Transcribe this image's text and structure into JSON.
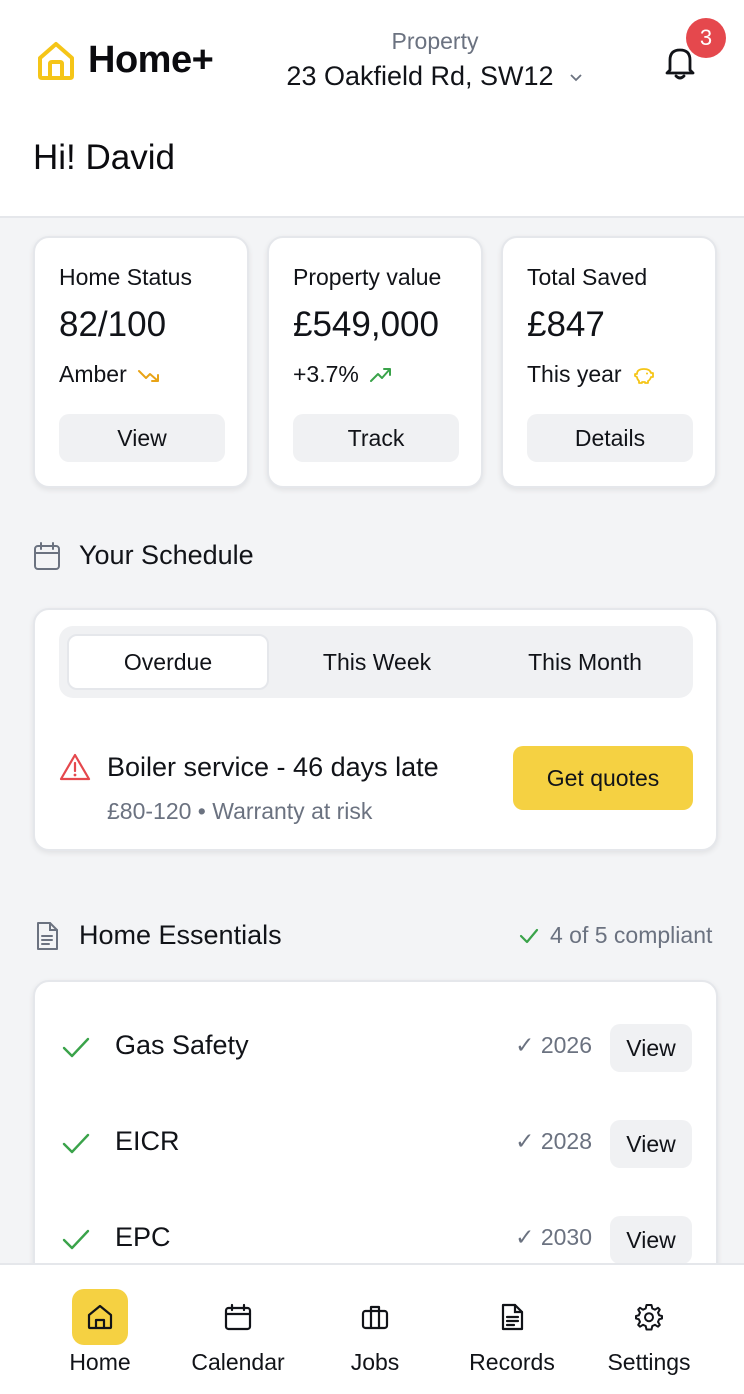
{
  "app": {
    "name": "Home+"
  },
  "header": {
    "property_label": "Property",
    "property_address": "23 Oakfield Rd, SW12",
    "notification_count": "3",
    "greeting": "Hi! David"
  },
  "stats": [
    {
      "label": "Home Status",
      "value": "82/100",
      "sub": "Amber",
      "sub_icon": "trend-down-icon",
      "button": "View"
    },
    {
      "label": "Property value",
      "value": "£549,000",
      "sub": "+3.7%",
      "sub_icon": "trend-up-icon",
      "button": "Track"
    },
    {
      "label": "Total Saved",
      "value": "£847",
      "sub": "This year",
      "sub_icon": "piggy-bank-icon",
      "button": "Details"
    }
  ],
  "schedule": {
    "title": "Your Schedule",
    "tabs": [
      "Overdue",
      "This Week",
      "This Month"
    ],
    "active_tab": "Overdue",
    "alert": {
      "title": "Boiler service - 46 days late",
      "subtitle": "£80-120 • Warranty at risk",
      "button": "Get quotes"
    }
  },
  "essentials": {
    "title": "Home Essentials",
    "compliance": "4 of 5 compliant",
    "items": [
      {
        "name": "Gas Safety",
        "year": "✓ 2026",
        "button": "View"
      },
      {
        "name": "EICR",
        "year": "✓ 2028",
        "button": "View"
      },
      {
        "name": "EPC",
        "year": "✓ 2030",
        "button": "View"
      }
    ]
  },
  "nav": [
    {
      "label": "Home",
      "icon": "home-icon",
      "active": true
    },
    {
      "label": "Calendar",
      "icon": "calendar-icon",
      "active": false
    },
    {
      "label": "Jobs",
      "icon": "briefcase-icon",
      "active": false
    },
    {
      "label": "Records",
      "icon": "document-icon",
      "active": false
    },
    {
      "label": "Settings",
      "icon": "gear-icon",
      "active": false
    }
  ],
  "colors": {
    "accent_yellow": "#f5d142",
    "alert_red": "#e5484d",
    "success_green": "#3aa34a",
    "amber": "#e8a317"
  }
}
